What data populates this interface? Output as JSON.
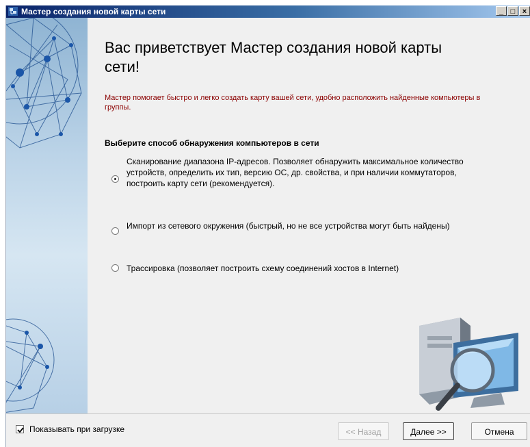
{
  "window": {
    "title": "Мастер создания новой карты сети",
    "controls": {
      "minimize": "_",
      "maximize": "□",
      "close": "×"
    }
  },
  "main": {
    "title": "Вас приветствует Мастер создания новой карты сети!",
    "description": "Мастер помогает быстро и легко создать карту вашей сети, удобно расположить найденные компьютеры в группы.",
    "section_title": "Выберите способ обнаружения компьютеров в сети",
    "options": [
      {
        "label": "Сканирование диапазона IP-адресов. Позволяет обнаружить максимальное количество устройств, определить их тип, версию ОС, др. свойства, и при наличии коммутаторов, построить карту сети (рекомендуется).",
        "selected": true
      },
      {
        "label": "Импорт из сетевого окружения (быстрый, но не все устройства могут быть найдены)",
        "selected": false
      },
      {
        "label": "Трассировка (позволяет построить схему соединений хостов в Internet)",
        "selected": false
      }
    ]
  },
  "footer": {
    "show_on_startup_label": "Показывать при загрузке",
    "show_on_startup_checked": true,
    "back_label": "<< Назад",
    "next_label": "Далее >>",
    "cancel_label": "Отмена"
  },
  "icons": {
    "app": "network-map-icon",
    "illustration": "computer-magnifier-icon",
    "banner": "network-mesh-graphic"
  },
  "colors": {
    "title_bar_start": "#0a246a",
    "title_bar_end": "#a6caf0",
    "description_text": "#8b0000",
    "banner_blue": "#8fb4d3",
    "window_bg": "#f0f0f0"
  }
}
